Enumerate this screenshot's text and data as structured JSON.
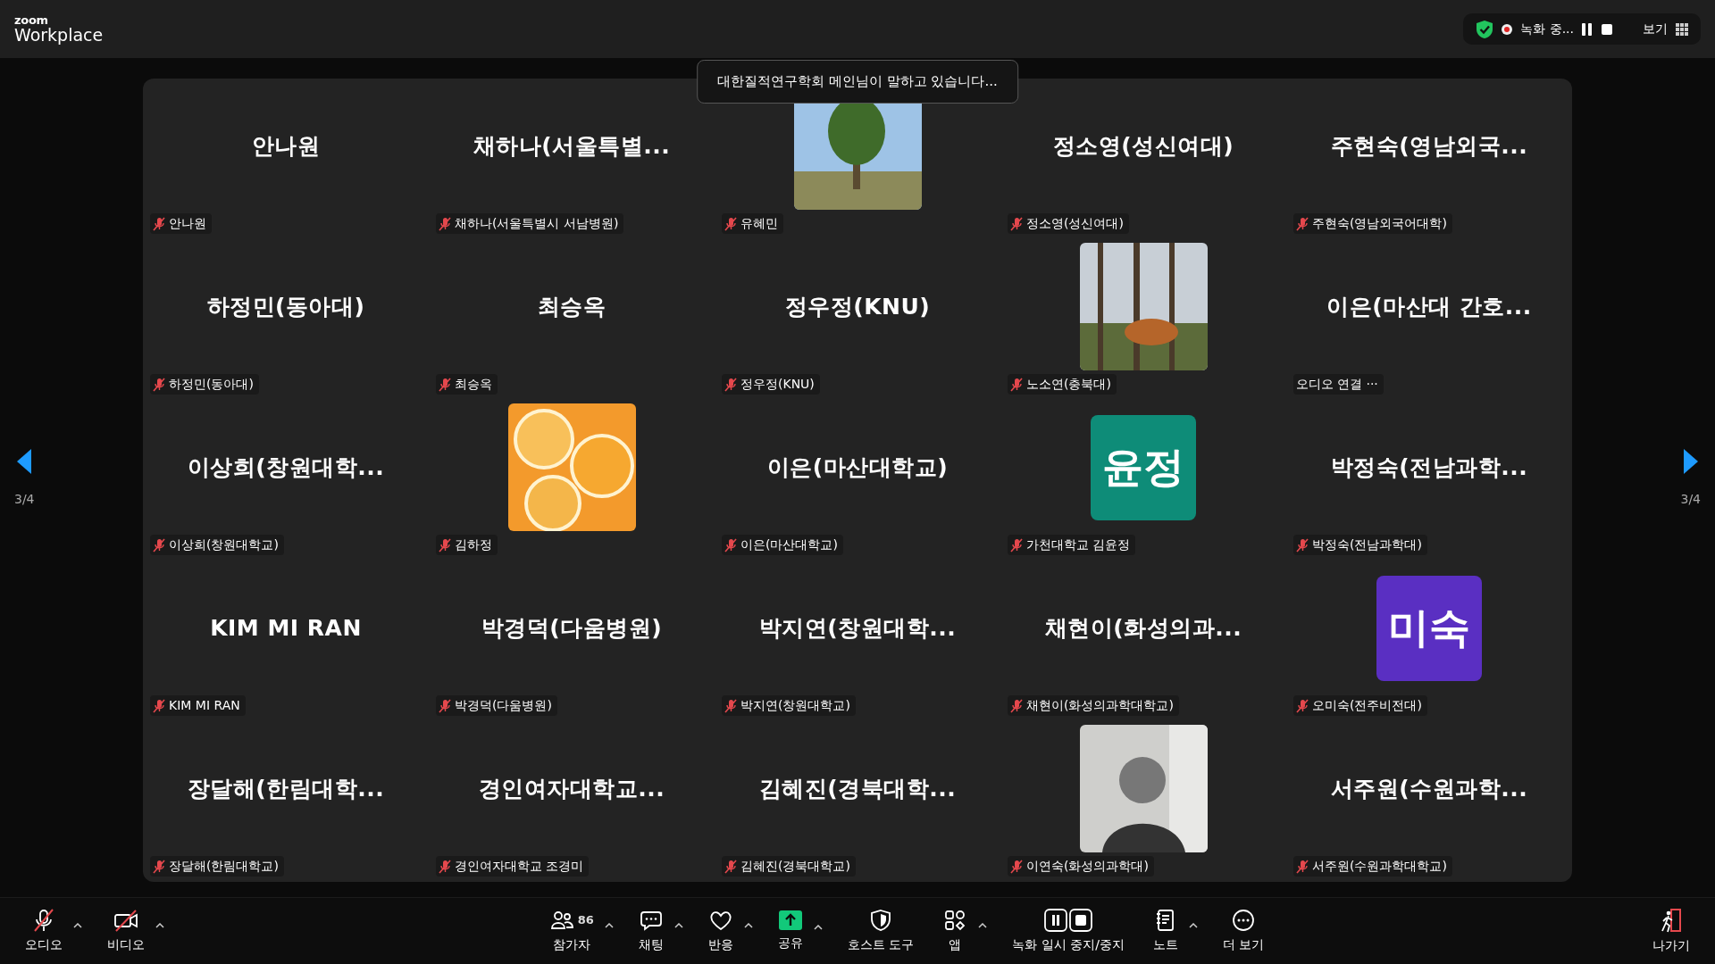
{
  "app": {
    "brand_small": "zoom",
    "brand": "Workplace"
  },
  "status": {
    "recording_label": "녹화 중...",
    "view_label": "보기"
  },
  "speaker_notice": "대한질적연구학회 메인님이 말하고 있습니다...",
  "pager": {
    "left": "3/4",
    "right": "3/4"
  },
  "tiles": [
    {
      "kind": "name",
      "display": "안나원",
      "label": "안나원",
      "muted": true
    },
    {
      "kind": "name",
      "display": "채하나(서울특별...",
      "label": "채하나(서울특별시 서남병원)",
      "muted": true
    },
    {
      "kind": "photo",
      "label": "유혜민",
      "muted": true
    },
    {
      "kind": "name",
      "display": "정소영(성신여대)",
      "label": "정소영(성신여대)",
      "muted": true
    },
    {
      "kind": "name",
      "display": "주현숙(영남외국...",
      "label": "주현숙(영남외국어대학)",
      "muted": true
    },
    {
      "kind": "name",
      "display": "하정민(동아대)",
      "label": "하정민(동아대)",
      "muted": true
    },
    {
      "kind": "name",
      "display": "최승옥",
      "label": "최승옥",
      "muted": true
    },
    {
      "kind": "name",
      "display": "정우정(KNU)",
      "label": "정우정(KNU)",
      "muted": true
    },
    {
      "kind": "photo",
      "label": "노소연(충북대)",
      "muted": true
    },
    {
      "kind": "name",
      "display": "이은(마산대 간호...",
      "label": "오디오 연결",
      "muted": false,
      "suffix": "···"
    },
    {
      "kind": "name",
      "display": "이상희(창원대학...",
      "label": "이상희(창원대학교)",
      "muted": true
    },
    {
      "kind": "photo",
      "label": "김하정",
      "muted": true
    },
    {
      "kind": "name",
      "display": "이은(마산대학교)",
      "label": "이은(마산대학교)",
      "muted": true
    },
    {
      "kind": "avatar",
      "initials": "윤정",
      "color": "#0e8c78",
      "label": "가천대학교 김윤정",
      "muted": true
    },
    {
      "kind": "name",
      "display": "박정숙(전남과학...",
      "label": "박정숙(전남과학대)",
      "muted": true
    },
    {
      "kind": "name",
      "display": "KIM MI RAN",
      "label": "KIM MI RAN",
      "muted": true
    },
    {
      "kind": "name",
      "display": "박경덕(다움병원)",
      "label": "박경덕(다움병원)",
      "muted": true
    },
    {
      "kind": "name",
      "display": "박지연(창원대학...",
      "label": "박지연(창원대학교)",
      "muted": true
    },
    {
      "kind": "name",
      "display": "채현이(화성의과...",
      "label": "채현이(화성의과학대학교)",
      "muted": true
    },
    {
      "kind": "avatar",
      "initials": "미숙",
      "color": "#5a2fc2",
      "label": "오미숙(전주비전대)",
      "muted": true
    },
    {
      "kind": "name",
      "display": "장달해(한림대학...",
      "label": "장달해(한림대학교)",
      "muted": true
    },
    {
      "kind": "name",
      "display": "경인여자대학교...",
      "label": "경인여자대학교 조경미",
      "muted": true
    },
    {
      "kind": "name",
      "display": "김혜진(경북대학...",
      "label": "김혜진(경북대학교)",
      "muted": true
    },
    {
      "kind": "photo",
      "label": "이연숙(화성의과학대)",
      "muted": true
    },
    {
      "kind": "name",
      "display": "서주원(수원과학...",
      "label": "서주원(수원과학대학교)",
      "muted": true
    }
  ],
  "toolbar": [
    {
      "label": "오디오",
      "caret": true
    },
    {
      "label": "비디오",
      "caret": true
    },
    {
      "label": "참가자",
      "count": "86",
      "caret": true
    },
    {
      "label": "채팅",
      "caret": true
    },
    {
      "label": "반응",
      "caret": true
    },
    {
      "label": "공유",
      "caret": true
    },
    {
      "label": "호스트 도구",
      "caret": false
    },
    {
      "label": "앱",
      "caret": true
    },
    {
      "label": "녹화 일시 중지/중지",
      "caret": false
    },
    {
      "label": "노트",
      "caret": true
    },
    {
      "label": "더 보기",
      "caret": false
    },
    {
      "label": "나가기",
      "caret": false
    }
  ]
}
